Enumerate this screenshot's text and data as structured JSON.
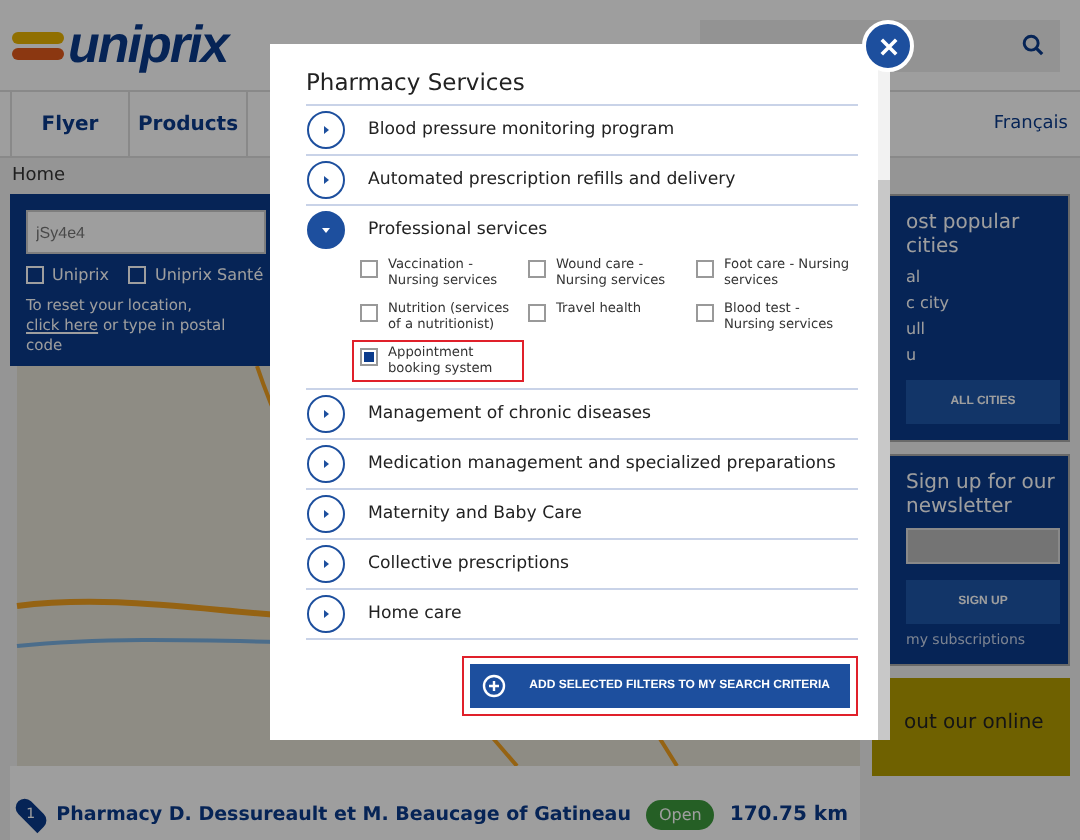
{
  "header": {
    "logo": "uniprix"
  },
  "nav": {
    "items": [
      {
        "label": "Flyer"
      },
      {
        "label": "Products"
      }
    ],
    "language": "Français"
  },
  "breadcrumb": "Home",
  "locator": {
    "search_value": "jSy4e4",
    "filters": [
      {
        "label": "Uniprix",
        "checked": false
      },
      {
        "label": "Uniprix Santé",
        "checked": false
      }
    ],
    "reset_text": "To reset your location,",
    "reset_link": "click here",
    "reset_tail": "or type in postal code"
  },
  "cities": {
    "title": "ost popular cities",
    "items": [
      "al",
      "c city",
      "ull",
      "u"
    ],
    "button": "ALL CITIES"
  },
  "newsletter": {
    "title": "Sign up for our newsletter",
    "button": "SIGN UP",
    "link": "my subscriptions"
  },
  "promo": {
    "text": "out our online"
  },
  "result": {
    "number": "1",
    "name": "Pharmacy D. Dessureault et M. Beaucage of Gatineau",
    "status": "Open",
    "distance": "170.75 km"
  },
  "modal": {
    "title": "Pharmacy Services",
    "sections": [
      {
        "label": "Blood pressure monitoring program",
        "expanded": false
      },
      {
        "label": "Automated prescription refills and delivery",
        "expanded": false
      },
      {
        "label": "Professional services",
        "expanded": true,
        "options": [
          {
            "label": "Vaccination - Nursing services",
            "checked": false,
            "highlighted": false
          },
          {
            "label": "Wound care - Nursing services",
            "checked": false,
            "highlighted": false
          },
          {
            "label": "Foot care - Nursing services",
            "checked": false,
            "highlighted": false
          },
          {
            "label": "Nutrition (services of a nutritionist)",
            "checked": false,
            "highlighted": false
          },
          {
            "label": "Travel health",
            "checked": false,
            "highlighted": false
          },
          {
            "label": "Blood test - Nursing services",
            "checked": false,
            "highlighted": false
          },
          {
            "label": "Appointment booking system",
            "checked": true,
            "highlighted": true
          }
        ]
      },
      {
        "label": "Management of chronic diseases",
        "expanded": false
      },
      {
        "label": "Medication management and specialized preparations",
        "expanded": false
      },
      {
        "label": "Maternity and Baby Care",
        "expanded": false
      },
      {
        "label": "Collective prescriptions",
        "expanded": false
      },
      {
        "label": "Home care",
        "expanded": false
      }
    ],
    "submit": {
      "label": "ADD SELECTED FILTERS TO MY SEARCH CRITERIA",
      "highlighted": true
    }
  }
}
